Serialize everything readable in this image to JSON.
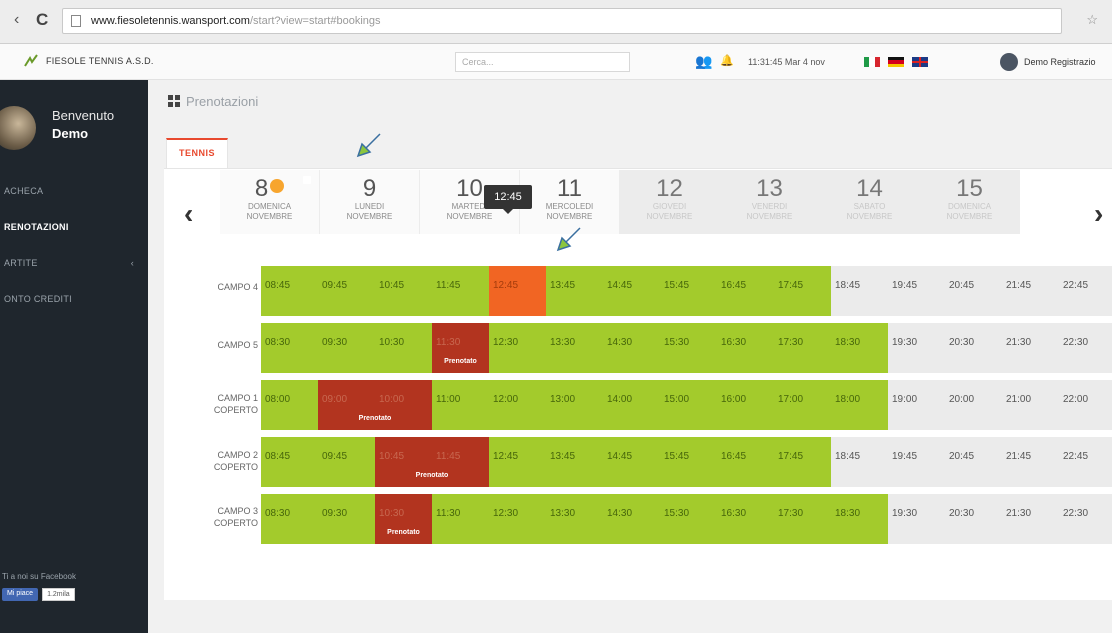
{
  "browser": {
    "url_host": "www.fiesoletennis.wansport.com",
    "url_path": "/start?view=start#bookings"
  },
  "header": {
    "club_name": "FIESOLE TENNIS A.S.D.",
    "search_placeholder": "Cerca...",
    "clock": "11:31:45 Mar 4 nov",
    "user_label": "Demo Registrazio"
  },
  "sidebar": {
    "welcome": "Benvenuto",
    "user": "Demo",
    "items": [
      {
        "label": "ACHECA",
        "active": false
      },
      {
        "label": "RENOTAZIONI",
        "active": true
      },
      {
        "label": "ARTITE",
        "active": false
      },
      {
        "label": "ONTO CREDITI",
        "active": false
      }
    ],
    "facebook_text": "Ti a noi su Facebook",
    "fb_like": "Mi piace",
    "fb_count": "1.2mila"
  },
  "page": {
    "title": "Prenotazioni",
    "tab": "TENNIS"
  },
  "days": [
    {
      "num": "8",
      "name": "DOMENICA",
      "month": "NOVEMBRE",
      "state": "selected"
    },
    {
      "num": "9",
      "name": "LUNEDI",
      "month": "NOVEMBRE",
      "state": "normal"
    },
    {
      "num": "10",
      "name": "MARTEDI",
      "month": "NOVEMBRE",
      "state": "normal"
    },
    {
      "num": "11",
      "name": "MERCOLEDI",
      "month": "NOVEMBRE",
      "state": "normal"
    },
    {
      "num": "12",
      "name": "GIOVEDI",
      "month": "NOVEMBRE",
      "state": "disabled"
    },
    {
      "num": "13",
      "name": "VENERDI",
      "month": "NOVEMBRE",
      "state": "disabled"
    },
    {
      "num": "14",
      "name": "SABATO",
      "month": "NOVEMBRE",
      "state": "disabled"
    },
    {
      "num": "15",
      "name": "DOMENICA",
      "month": "NOVEMBRE",
      "state": "disabled"
    }
  ],
  "tooltip": "12:45",
  "booked_label": "Prenotato",
  "courts": [
    {
      "name": [
        "CAMPO 4"
      ],
      "slots": [
        {
          "t": "08:45",
          "s": "free"
        },
        {
          "t": "09:45",
          "s": "free"
        },
        {
          "t": "10:45",
          "s": "free"
        },
        {
          "t": "11:45",
          "s": "free"
        },
        {
          "t": "12:45",
          "s": "sel"
        },
        {
          "t": "13:45",
          "s": "free"
        },
        {
          "t": "14:45",
          "s": "free"
        },
        {
          "t": "15:45",
          "s": "free"
        },
        {
          "t": "16:45",
          "s": "free"
        },
        {
          "t": "17:45",
          "s": "free"
        },
        {
          "t": "18:45",
          "s": "off"
        },
        {
          "t": "19:45",
          "s": "off"
        },
        {
          "t": "20:45",
          "s": "off"
        },
        {
          "t": "21:45",
          "s": "off"
        },
        {
          "t": "22:45",
          "s": "off"
        }
      ]
    },
    {
      "name": [
        "CAMPO 5"
      ],
      "slots": [
        {
          "t": "08:30",
          "s": "free"
        },
        {
          "t": "09:30",
          "s": "free"
        },
        {
          "t": "10:30",
          "s": "free"
        },
        {
          "t": "11:30",
          "s": "booked"
        },
        {
          "t": "12:30",
          "s": "free"
        },
        {
          "t": "13:30",
          "s": "free"
        },
        {
          "t": "14:30",
          "s": "free"
        },
        {
          "t": "15:30",
          "s": "free"
        },
        {
          "t": "16:30",
          "s": "free"
        },
        {
          "t": "17:30",
          "s": "free"
        },
        {
          "t": "18:30",
          "s": "free"
        },
        {
          "t": "19:30",
          "s": "off"
        },
        {
          "t": "20:30",
          "s": "off"
        },
        {
          "t": "21:30",
          "s": "off"
        },
        {
          "t": "22:30",
          "s": "off"
        }
      ]
    },
    {
      "name": [
        "CAMPO 1",
        "COPERTO"
      ],
      "slots": [
        {
          "t": "08:00",
          "s": "free"
        },
        {
          "t": "09:00",
          "s": "booked"
        },
        {
          "t": "10:00",
          "s": "booked"
        },
        {
          "t": "11:00",
          "s": "free"
        },
        {
          "t": "12:00",
          "s": "free"
        },
        {
          "t": "13:00",
          "s": "free"
        },
        {
          "t": "14:00",
          "s": "free"
        },
        {
          "t": "15:00",
          "s": "free"
        },
        {
          "t": "16:00",
          "s": "free"
        },
        {
          "t": "17:00",
          "s": "free"
        },
        {
          "t": "18:00",
          "s": "free"
        },
        {
          "t": "19:00",
          "s": "off"
        },
        {
          "t": "20:00",
          "s": "off"
        },
        {
          "t": "21:00",
          "s": "off"
        },
        {
          "t": "22:00",
          "s": "off"
        }
      ]
    },
    {
      "name": [
        "CAMPO 2",
        "COPERTO"
      ],
      "slots": [
        {
          "t": "08:45",
          "s": "free"
        },
        {
          "t": "09:45",
          "s": "free"
        },
        {
          "t": "10:45",
          "s": "booked"
        },
        {
          "t": "11:45",
          "s": "booked"
        },
        {
          "t": "12:45",
          "s": "free"
        },
        {
          "t": "13:45",
          "s": "free"
        },
        {
          "t": "14:45",
          "s": "free"
        },
        {
          "t": "15:45",
          "s": "free"
        },
        {
          "t": "16:45",
          "s": "free"
        },
        {
          "t": "17:45",
          "s": "free"
        },
        {
          "t": "18:45",
          "s": "off"
        },
        {
          "t": "19:45",
          "s": "off"
        },
        {
          "t": "20:45",
          "s": "off"
        },
        {
          "t": "21:45",
          "s": "off"
        },
        {
          "t": "22:45",
          "s": "off"
        }
      ]
    },
    {
      "name": [
        "CAMPO 3",
        "COPERTO"
      ],
      "slots": [
        {
          "t": "08:30",
          "s": "free"
        },
        {
          "t": "09:30",
          "s": "free"
        },
        {
          "t": "10:30",
          "s": "booked"
        },
        {
          "t": "11:30",
          "s": "free"
        },
        {
          "t": "12:30",
          "s": "free"
        },
        {
          "t": "13:30",
          "s": "free"
        },
        {
          "t": "14:30",
          "s": "free"
        },
        {
          "t": "15:30",
          "s": "free"
        },
        {
          "t": "16:30",
          "s": "free"
        },
        {
          "t": "17:30",
          "s": "free"
        },
        {
          "t": "18:30",
          "s": "free"
        },
        {
          "t": "19:30",
          "s": "off"
        },
        {
          "t": "20:30",
          "s": "off"
        },
        {
          "t": "21:30",
          "s": "off"
        },
        {
          "t": "22:30",
          "s": "off"
        }
      ]
    }
  ],
  "colors": {
    "free": "#a3cb2c",
    "selected": "#f16523",
    "booked": "#b2341f",
    "unavailable": "#ebebeb",
    "day_selected": "#2f8fd8",
    "sidebar": "#1f262d",
    "tab_accent": "#e8492e"
  }
}
